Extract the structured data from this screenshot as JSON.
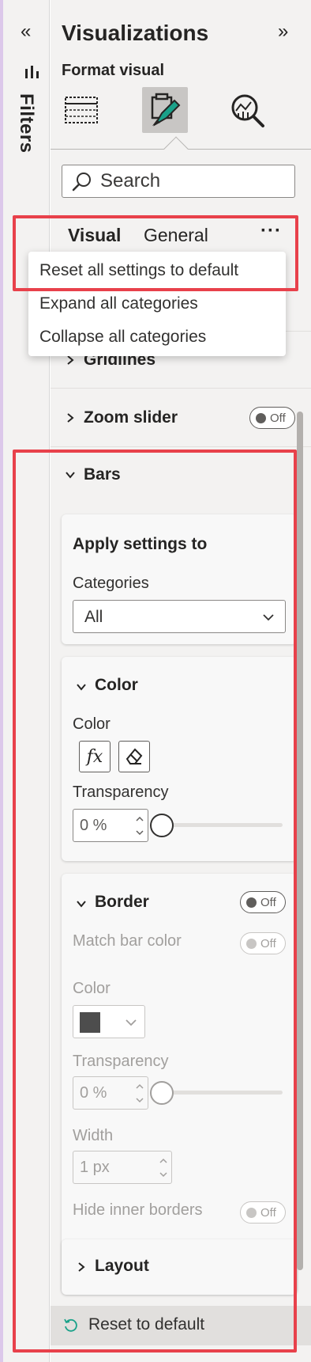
{
  "filters_rail": {
    "collapse_glyph": "«",
    "label": "Filters"
  },
  "header": {
    "title": "Visualizations",
    "expand_glyph": "»",
    "subtitle": "Format visual"
  },
  "search": {
    "placeholder": "Search"
  },
  "pane_tabs": {
    "visual": "Visual",
    "general": "General",
    "more": "···"
  },
  "context_menu": {
    "items": [
      "Reset all settings to default",
      "Expand all categories",
      "Collapse all categories"
    ]
  },
  "sections": {
    "gridlines": "Gridlines",
    "zoom_slider": "Zoom slider",
    "zoom_slider_toggle": "Off",
    "bars": "Bars"
  },
  "bars": {
    "apply": {
      "title": "Apply settings to",
      "categories_label": "Categories",
      "categories_value": "All"
    },
    "color": {
      "title": "Color",
      "color_label": "Color",
      "transparency_label": "Transparency",
      "transparency_value": "0 %",
      "transparency_level": 0
    },
    "border": {
      "title": "Border",
      "toggle": "Off",
      "match_bar_color_label": "Match bar color",
      "match_bar_color_toggle": "Off",
      "color_label": "Color",
      "color_value": "#4d4d4d",
      "transparency_label": "Transparency",
      "transparency_value": "0 %",
      "transparency_level": 0,
      "width_label": "Width",
      "width_value": "1 px",
      "hide_inner_borders_label": "Hide inner borders",
      "hide_inner_borders_toggle": "Off"
    },
    "layout": {
      "title": "Layout"
    }
  },
  "reset": {
    "label": "Reset to default"
  },
  "colors": {
    "highlight": "#e8414b",
    "panel_bg": "#f3f2f1",
    "active_tab_bg": "#c8c6c4",
    "paintbrush_accent": "#1aa189"
  }
}
